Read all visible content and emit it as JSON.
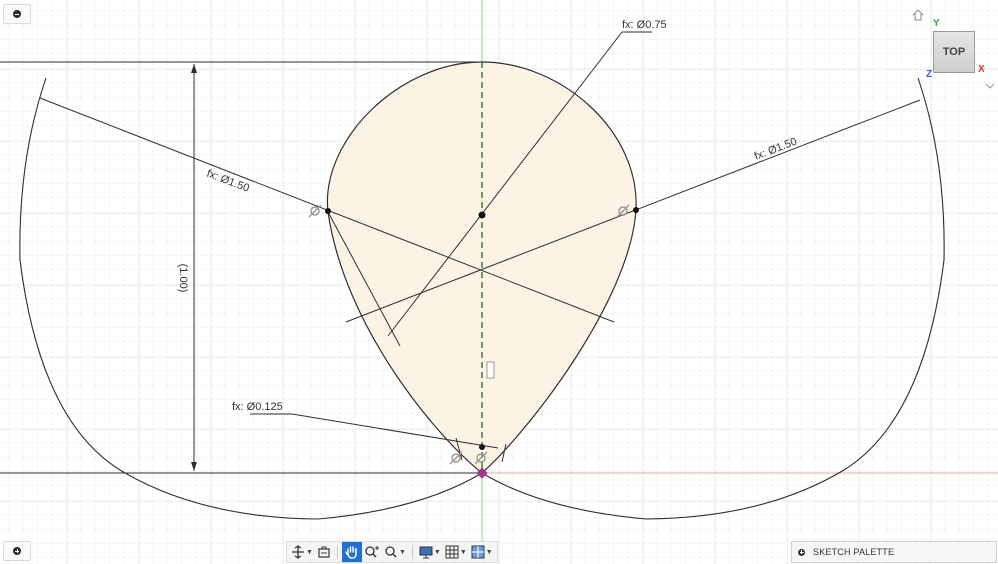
{
  "viewcube": {
    "face_label": "TOP",
    "axes": {
      "y": "Y",
      "x": "X",
      "z": "Z"
    }
  },
  "dimensions": {
    "top_diameter": "fx: Ø0.75",
    "left_diameter": "fx: Ø1.50",
    "right_diameter": "fx: Ø1.50",
    "bottom_diameter": "fx: Ø0.125",
    "height": "(1.00)"
  },
  "sketch_palette": {
    "label": "SKETCH PALETTE"
  },
  "toolbar": {
    "tools": [
      "orbit-icon",
      "look-at-icon",
      "pan-icon",
      "zoom-icon",
      "fit-icon",
      "display-settings-icon",
      "grid-settings-icon",
      "viewports-icon"
    ],
    "active_tool": "pan-icon"
  },
  "colors": {
    "sketch_fill": "#fdf3e5",
    "sketch_line": "#2e2e2e",
    "x_axis": "#e05a5a",
    "y_axis": "#4caf50",
    "toolbar_active": "#1f6fd1",
    "origin": "#9b3a8a"
  }
}
